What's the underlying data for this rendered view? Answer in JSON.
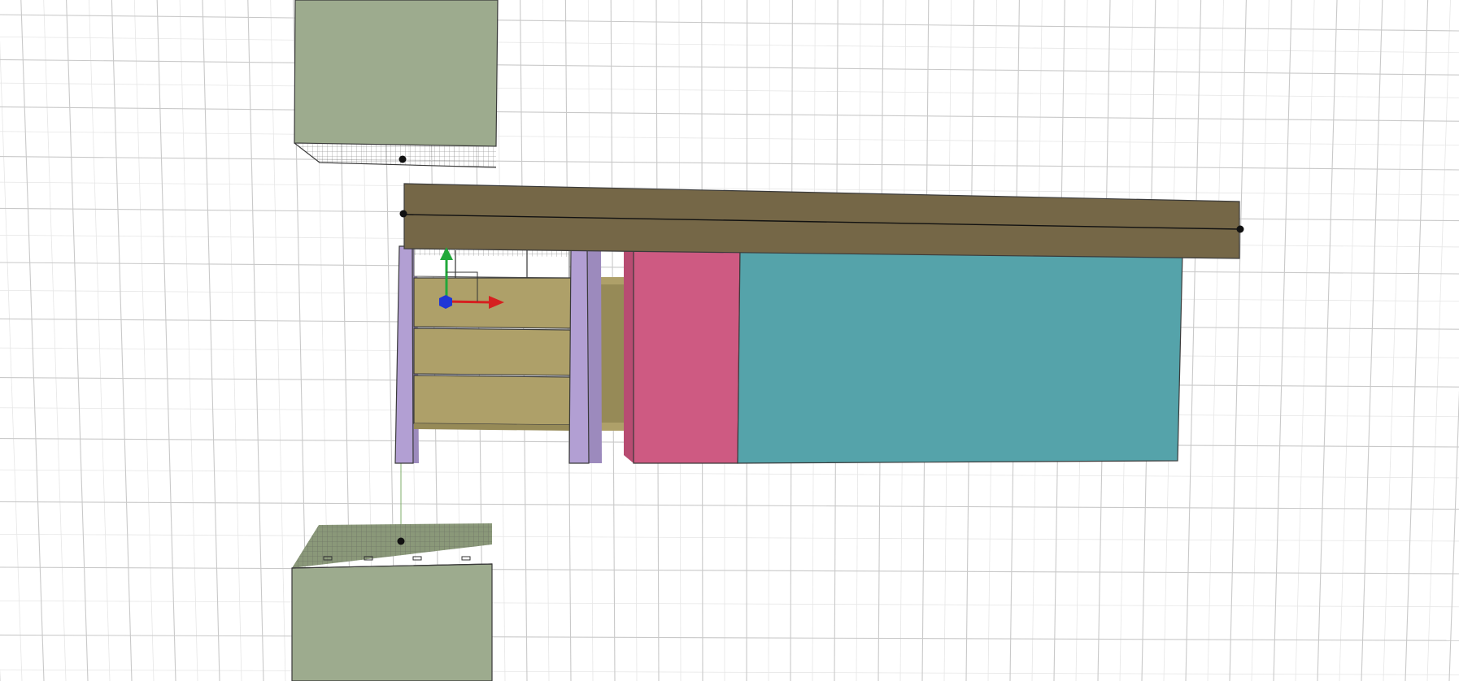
{
  "viewport": {
    "background": "#ffffff",
    "grid_major_color": "#c9c9c9",
    "grid_minor_color": "#e6e6e6",
    "edge_color": "#3a3a3a"
  },
  "objects": {
    "upper_cabinet": {
      "color": "#9dab8e",
      "shade": "#8a9879"
    },
    "lower_cabinet": {
      "color": "#9dab8e",
      "shade": "#8a9879"
    },
    "beam": {
      "color": "#756747",
      "shade": "#655a3d"
    },
    "left_post": {
      "color": "#b29fd3",
      "shade": "#9c8abd"
    },
    "right_post": {
      "color": "#b29fd3",
      "shade": "#9c8abd"
    },
    "drawer_unit": {
      "color": "#aea069",
      "shade": "#968a57"
    },
    "pink_panel": {
      "color": "#ce5a82",
      "shade": "#b84c72"
    },
    "teal_block": {
      "color": "#55a3aa",
      "shade": "#4a9299"
    }
  },
  "gizmo": {
    "x_axis_color": "#d62020",
    "y_axis_color": "#21a83a",
    "z_axis_color": "#1f36d6"
  },
  "icons": [
    "move-gizmo-icon",
    "pivot-point-icon"
  ]
}
